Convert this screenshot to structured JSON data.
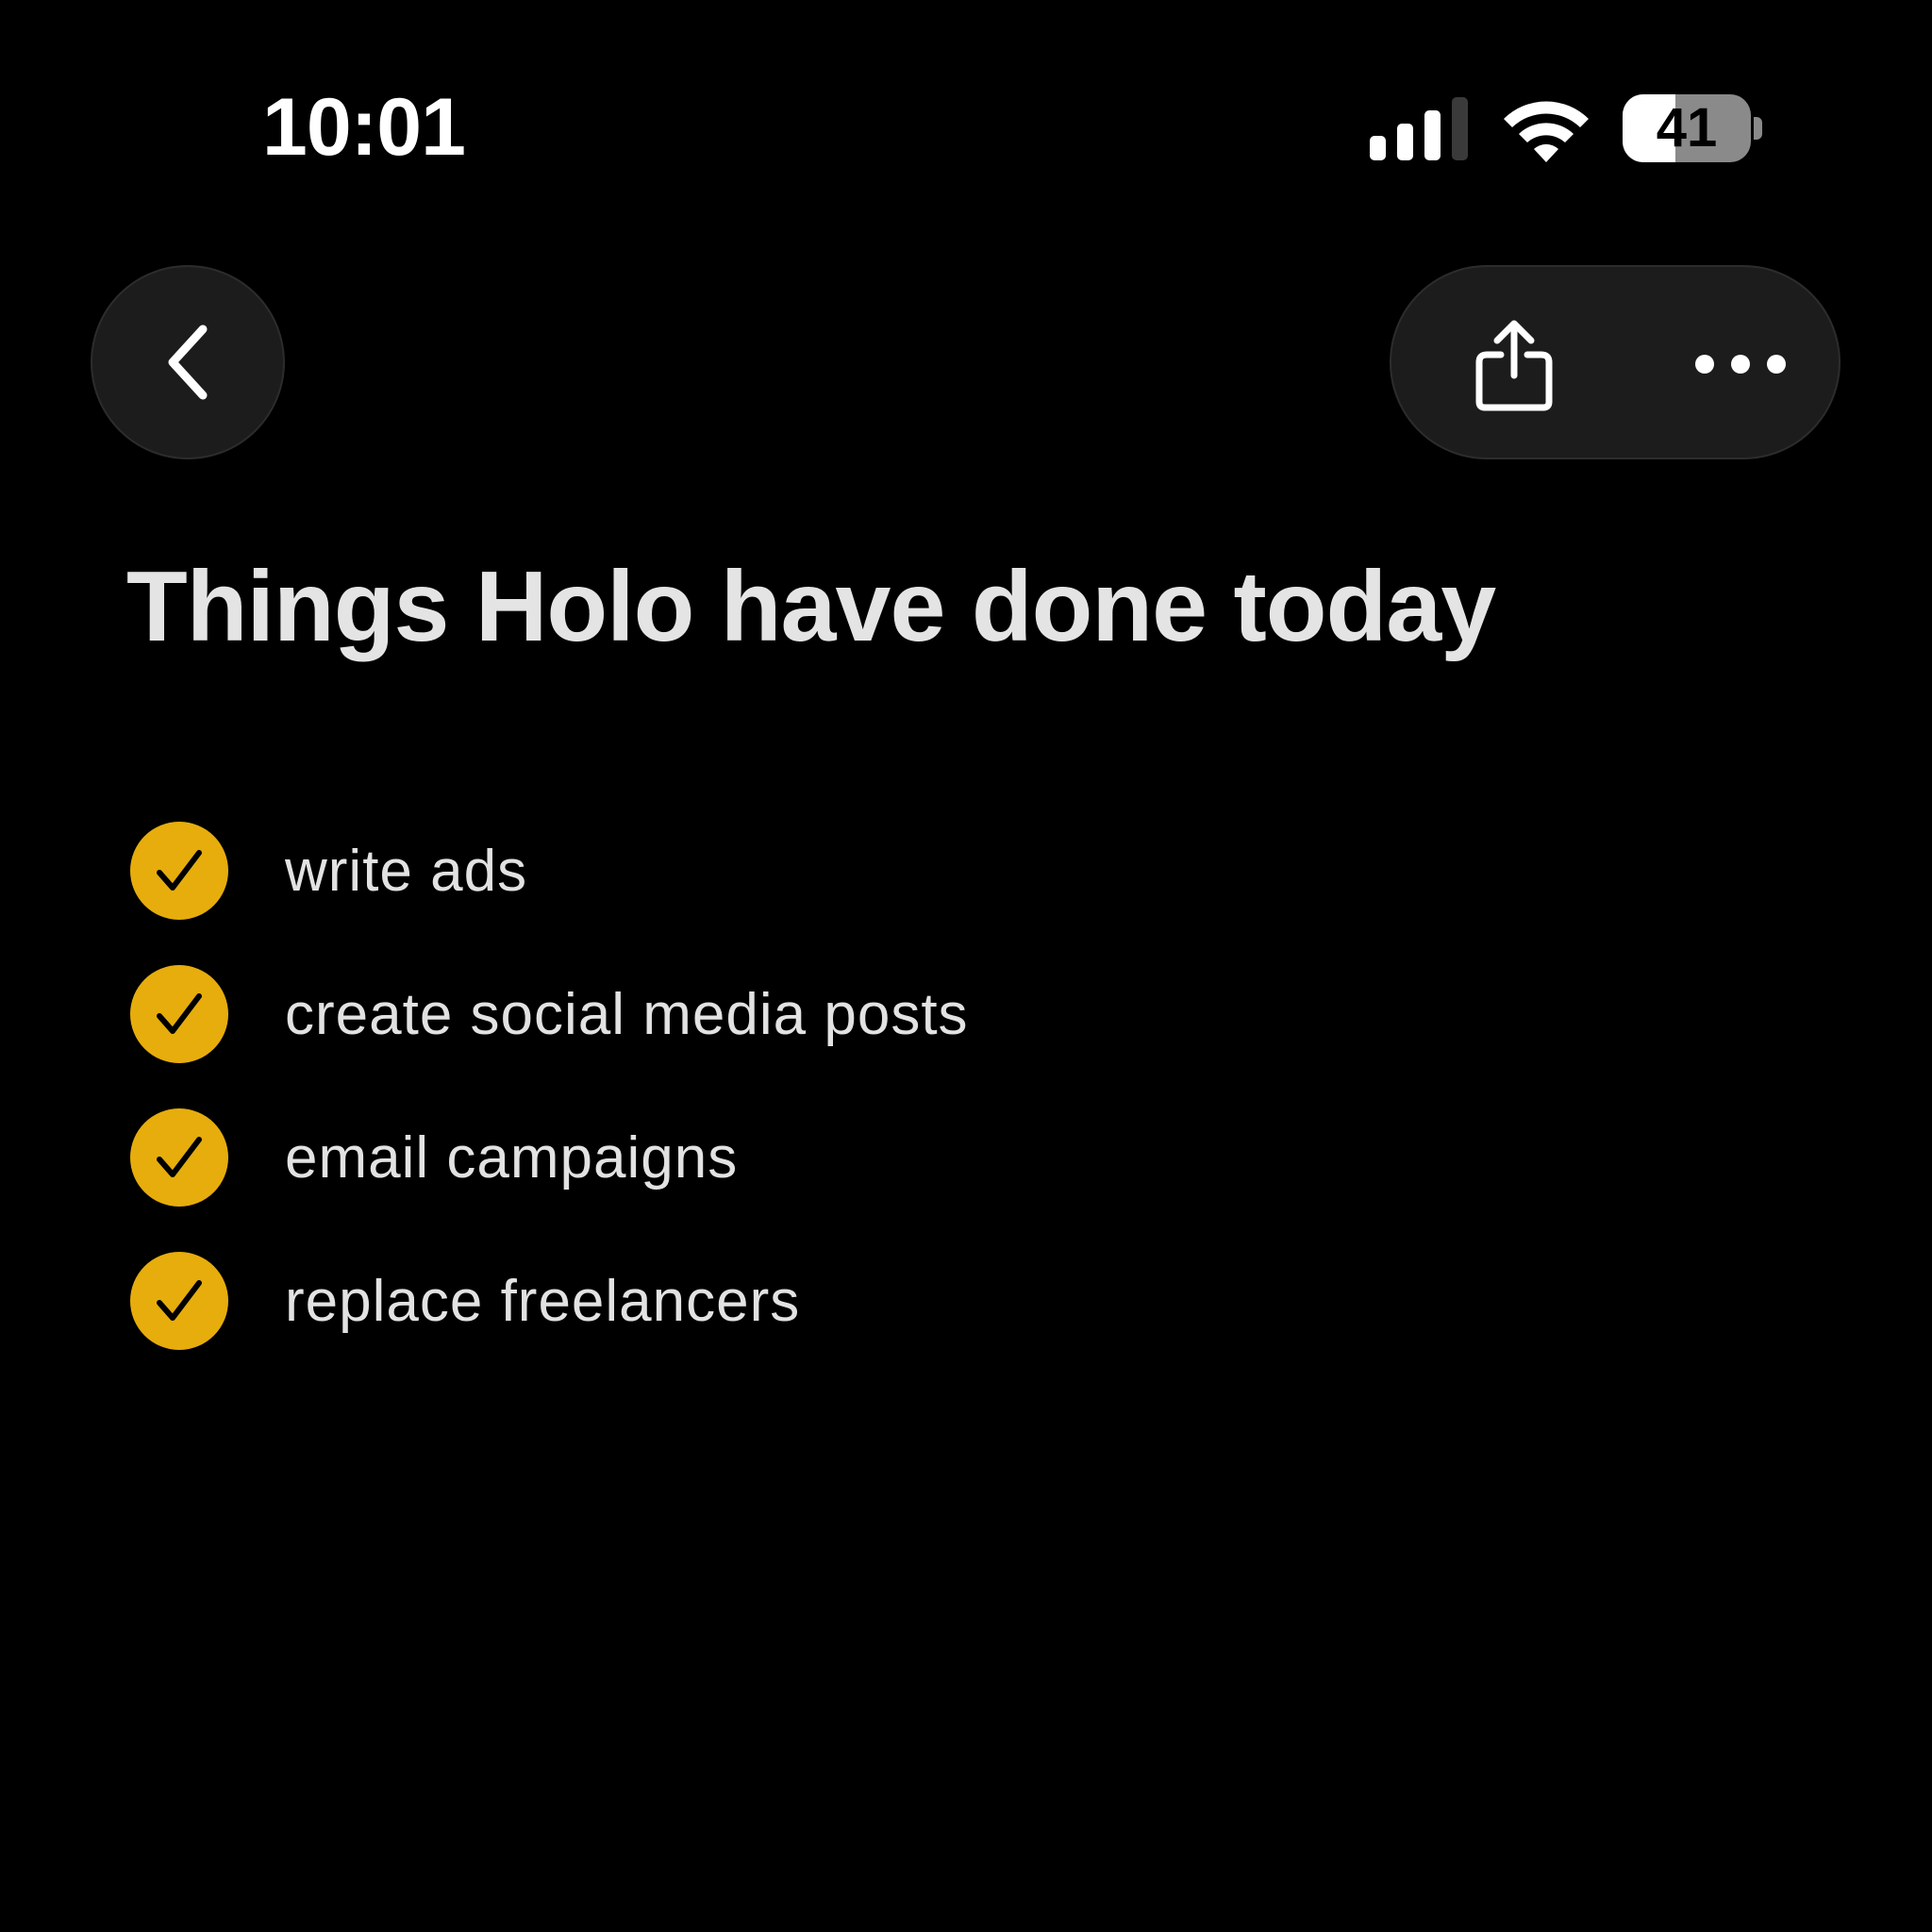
{
  "status_bar": {
    "time": "10:01",
    "battery_level": "41",
    "battery_percent": 41
  },
  "nav": {
    "back_icon": "chevron-left-icon",
    "share_icon": "share-icon",
    "more_icon": "ellipsis-icon"
  },
  "note": {
    "title": "Things Holo have done today",
    "items": [
      {
        "label": "write ads",
        "checked": true
      },
      {
        "label": "create social media posts",
        "checked": true
      },
      {
        "label": "email campaigns",
        "checked": true
      },
      {
        "label": "replace freelancers",
        "checked": true
      }
    ]
  },
  "colors": {
    "background": "#000000",
    "check_accent": "#e6ad0c",
    "button_surface": "#1c1c1c",
    "text": "#e4e4e4"
  }
}
